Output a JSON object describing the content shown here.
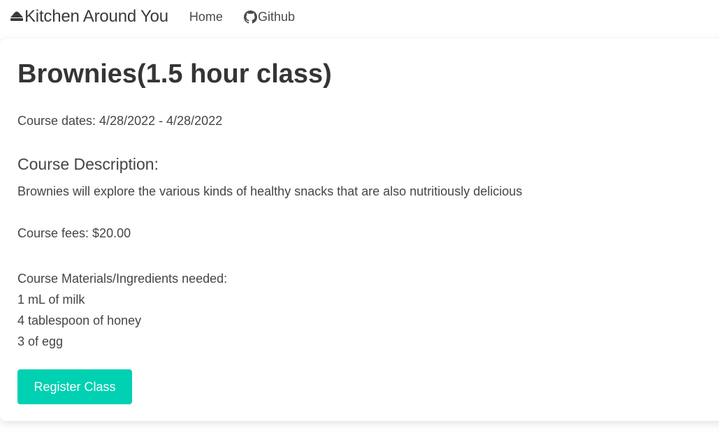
{
  "navbar": {
    "brand_icon": "hat-icon",
    "brand": "Kitchen Around You",
    "home": "Home",
    "github_icon": "github-icon",
    "github": "Github"
  },
  "course": {
    "title": "Brownies(1.5 hour class)",
    "dates": "Course dates: 4/28/2022 - 4/28/2022",
    "description_heading": "Course Description:",
    "description": "Brownies will explore the various kinds of healthy snacks that are also nutritiously delicious",
    "fees": "Course fees: $20.00",
    "materials_heading": "Course Materials/Ingredients needed:",
    "materials": [
      "1 mL of milk",
      "4 tablespoon of honey",
      "3 of egg"
    ],
    "register_button": "Register Class"
  },
  "colors": {
    "accent": "#00d1b2",
    "text": "#454545"
  }
}
